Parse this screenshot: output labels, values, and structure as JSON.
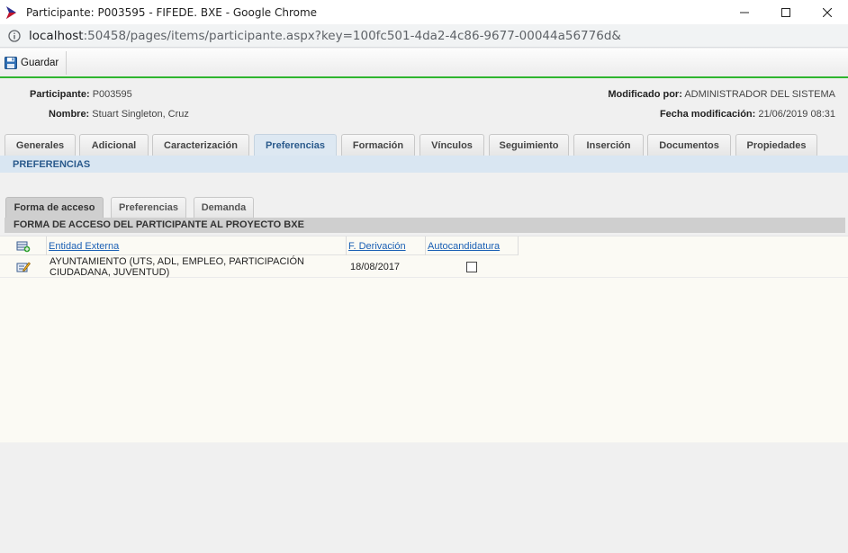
{
  "window": {
    "title": "Participante: P003595 - FIFEDE. BXE - Google Chrome",
    "url_host": "localhost",
    "url_rest": ":50458/pages/items/participante.aspx?key=100fc501-4da2-4c86-9677-00044a56776d&",
    "accent_color": "#2fb52f"
  },
  "toolbar": {
    "save_label": "Guardar"
  },
  "header": {
    "participante_label": "Participante:",
    "participante_value": "P003595",
    "nombre_label": "Nombre:",
    "nombre_value": "Stuart Singleton, Cruz",
    "modificado_label": "Modificado por:",
    "modificado_value": "ADMINISTRADOR DEL SISTEMA",
    "fecha_label": "Fecha modificación:",
    "fecha_value": "21/06/2019 08:31"
  },
  "tabs": [
    {
      "label": "Generales"
    },
    {
      "label": "Adicional"
    },
    {
      "label": "Caracterización"
    },
    {
      "label": "Preferencias",
      "active": true
    },
    {
      "label": "Formación"
    },
    {
      "label": "Vínculos"
    },
    {
      "label": "Seguimiento"
    },
    {
      "label": "Inserción"
    },
    {
      "label": "Documentos"
    },
    {
      "label": "Propiedades"
    }
  ],
  "section_title": "PREFERENCIAS",
  "subtabs": [
    {
      "label": "Forma de acceso",
      "active": true
    },
    {
      "label": "Preferencias"
    },
    {
      "label": "Demanda"
    }
  ],
  "subsection_title": "FORMA DE ACCESO DEL PARTICIPANTE AL PROYECTO BXE",
  "grid": {
    "columns": [
      "Entidad Externa",
      "F. Derivación",
      "Autocandidatura"
    ],
    "rows": [
      {
        "entidad_line1": "AYUNTAMIENTO (UTS, ADL, EMPLEO, PARTICIPACIÓN",
        "entidad_line2": "CIUDADANA, JUVENTUD)",
        "fecha": "18/08/2017",
        "autocandidatura": false
      }
    ]
  },
  "icons": {
    "app": "fifede-logo-icon",
    "info": "info-icon",
    "save": "floppy-disk-icon",
    "add_row": "add-row-icon",
    "edit_row": "edit-row-icon"
  }
}
